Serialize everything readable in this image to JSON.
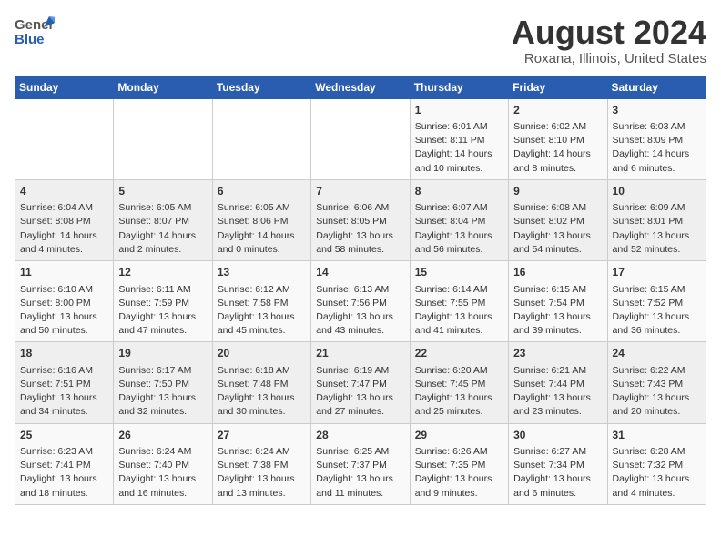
{
  "header": {
    "logo_line1": "General",
    "logo_line2": "Blue",
    "title": "August 2024",
    "subtitle": "Roxana, Illinois, United States"
  },
  "days_of_week": [
    "Sunday",
    "Monday",
    "Tuesday",
    "Wednesday",
    "Thursday",
    "Friday",
    "Saturday"
  ],
  "weeks": [
    [
      {
        "day": "",
        "content": ""
      },
      {
        "day": "",
        "content": ""
      },
      {
        "day": "",
        "content": ""
      },
      {
        "day": "",
        "content": ""
      },
      {
        "day": "1",
        "content": "Sunrise: 6:01 AM\nSunset: 8:11 PM\nDaylight: 14 hours\nand 10 minutes."
      },
      {
        "day": "2",
        "content": "Sunrise: 6:02 AM\nSunset: 8:10 PM\nDaylight: 14 hours\nand 8 minutes."
      },
      {
        "day": "3",
        "content": "Sunrise: 6:03 AM\nSunset: 8:09 PM\nDaylight: 14 hours\nand 6 minutes."
      }
    ],
    [
      {
        "day": "4",
        "content": "Sunrise: 6:04 AM\nSunset: 8:08 PM\nDaylight: 14 hours\nand 4 minutes."
      },
      {
        "day": "5",
        "content": "Sunrise: 6:05 AM\nSunset: 8:07 PM\nDaylight: 14 hours\nand 2 minutes."
      },
      {
        "day": "6",
        "content": "Sunrise: 6:05 AM\nSunset: 8:06 PM\nDaylight: 14 hours\nand 0 minutes."
      },
      {
        "day": "7",
        "content": "Sunrise: 6:06 AM\nSunset: 8:05 PM\nDaylight: 13 hours\nand 58 minutes."
      },
      {
        "day": "8",
        "content": "Sunrise: 6:07 AM\nSunset: 8:04 PM\nDaylight: 13 hours\nand 56 minutes."
      },
      {
        "day": "9",
        "content": "Sunrise: 6:08 AM\nSunset: 8:02 PM\nDaylight: 13 hours\nand 54 minutes."
      },
      {
        "day": "10",
        "content": "Sunrise: 6:09 AM\nSunset: 8:01 PM\nDaylight: 13 hours\nand 52 minutes."
      }
    ],
    [
      {
        "day": "11",
        "content": "Sunrise: 6:10 AM\nSunset: 8:00 PM\nDaylight: 13 hours\nand 50 minutes."
      },
      {
        "day": "12",
        "content": "Sunrise: 6:11 AM\nSunset: 7:59 PM\nDaylight: 13 hours\nand 47 minutes."
      },
      {
        "day": "13",
        "content": "Sunrise: 6:12 AM\nSunset: 7:58 PM\nDaylight: 13 hours\nand 45 minutes."
      },
      {
        "day": "14",
        "content": "Sunrise: 6:13 AM\nSunset: 7:56 PM\nDaylight: 13 hours\nand 43 minutes."
      },
      {
        "day": "15",
        "content": "Sunrise: 6:14 AM\nSunset: 7:55 PM\nDaylight: 13 hours\nand 41 minutes."
      },
      {
        "day": "16",
        "content": "Sunrise: 6:15 AM\nSunset: 7:54 PM\nDaylight: 13 hours\nand 39 minutes."
      },
      {
        "day": "17",
        "content": "Sunrise: 6:15 AM\nSunset: 7:52 PM\nDaylight: 13 hours\nand 36 minutes."
      }
    ],
    [
      {
        "day": "18",
        "content": "Sunrise: 6:16 AM\nSunset: 7:51 PM\nDaylight: 13 hours\nand 34 minutes."
      },
      {
        "day": "19",
        "content": "Sunrise: 6:17 AM\nSunset: 7:50 PM\nDaylight: 13 hours\nand 32 minutes."
      },
      {
        "day": "20",
        "content": "Sunrise: 6:18 AM\nSunset: 7:48 PM\nDaylight: 13 hours\nand 30 minutes."
      },
      {
        "day": "21",
        "content": "Sunrise: 6:19 AM\nSunset: 7:47 PM\nDaylight: 13 hours\nand 27 minutes."
      },
      {
        "day": "22",
        "content": "Sunrise: 6:20 AM\nSunset: 7:45 PM\nDaylight: 13 hours\nand 25 minutes."
      },
      {
        "day": "23",
        "content": "Sunrise: 6:21 AM\nSunset: 7:44 PM\nDaylight: 13 hours\nand 23 minutes."
      },
      {
        "day": "24",
        "content": "Sunrise: 6:22 AM\nSunset: 7:43 PM\nDaylight: 13 hours\nand 20 minutes."
      }
    ],
    [
      {
        "day": "25",
        "content": "Sunrise: 6:23 AM\nSunset: 7:41 PM\nDaylight: 13 hours\nand 18 minutes."
      },
      {
        "day": "26",
        "content": "Sunrise: 6:24 AM\nSunset: 7:40 PM\nDaylight: 13 hours\nand 16 minutes."
      },
      {
        "day": "27",
        "content": "Sunrise: 6:24 AM\nSunset: 7:38 PM\nDaylight: 13 hours\nand 13 minutes."
      },
      {
        "day": "28",
        "content": "Sunrise: 6:25 AM\nSunset: 7:37 PM\nDaylight: 13 hours\nand 11 minutes."
      },
      {
        "day": "29",
        "content": "Sunrise: 6:26 AM\nSunset: 7:35 PM\nDaylight: 13 hours\nand 9 minutes."
      },
      {
        "day": "30",
        "content": "Sunrise: 6:27 AM\nSunset: 7:34 PM\nDaylight: 13 hours\nand 6 minutes."
      },
      {
        "day": "31",
        "content": "Sunrise: 6:28 AM\nSunset: 7:32 PM\nDaylight: 13 hours\nand 4 minutes."
      }
    ]
  ]
}
